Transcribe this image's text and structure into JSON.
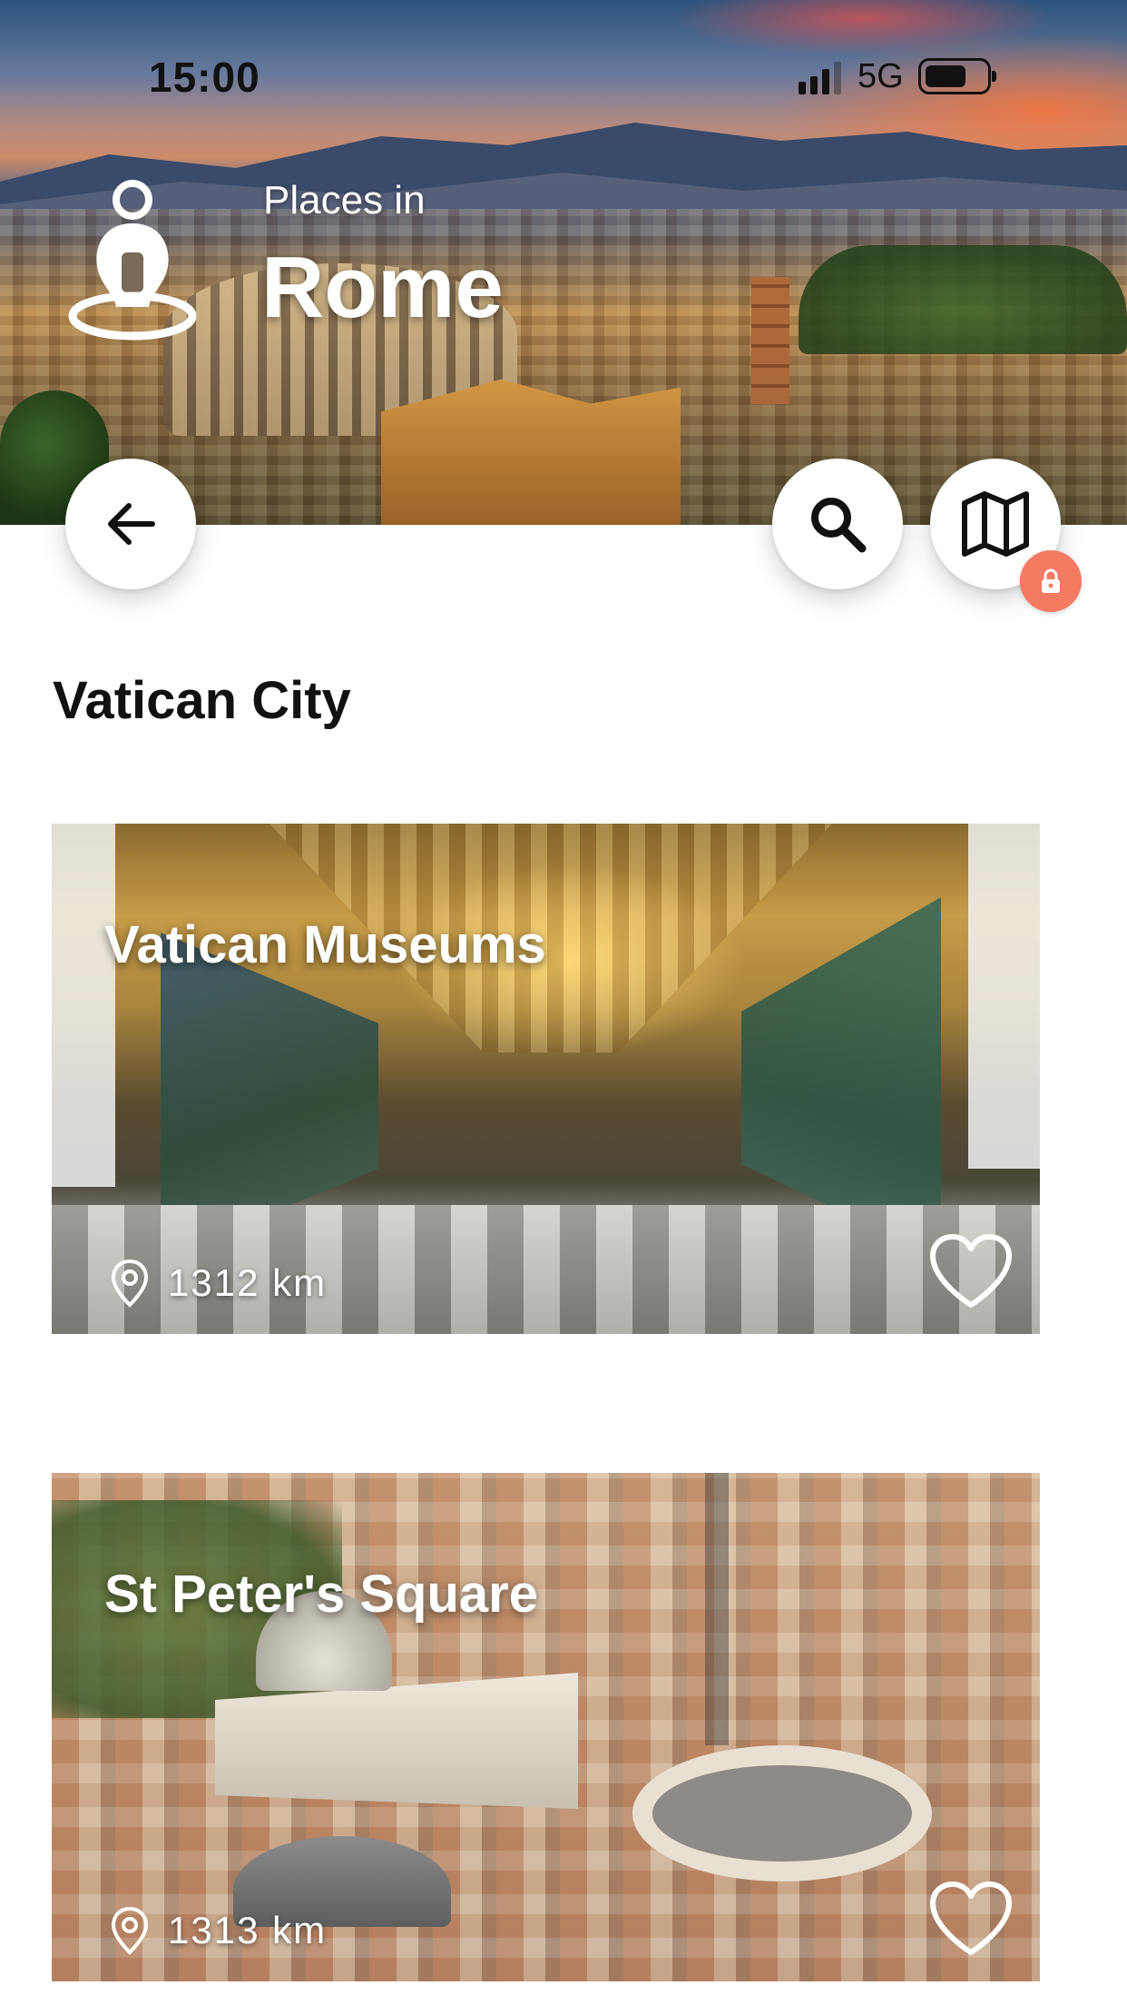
{
  "status_bar": {
    "time": "15:00",
    "network": "5G"
  },
  "hero": {
    "subtitle": "Places in",
    "city": "Rome"
  },
  "buttons": {
    "back_icon": "arrow-left-icon",
    "search_icon": "search-icon",
    "map_icon": "map-icon",
    "map_locked_badge_icon": "lock-icon"
  },
  "section": {
    "title": "Vatican City"
  },
  "places": [
    {
      "name": "Vatican Museums",
      "distance": "1312 km",
      "favorite_icon": "heart-outline-icon"
    },
    {
      "name": "St Peter's Square",
      "distance": "1313 km",
      "favorite_icon": "heart-outline-icon"
    }
  ],
  "colors": {
    "lock_badge": "#f47a62",
    "button_bg": "#ffffff",
    "text_dark": "#111111"
  }
}
